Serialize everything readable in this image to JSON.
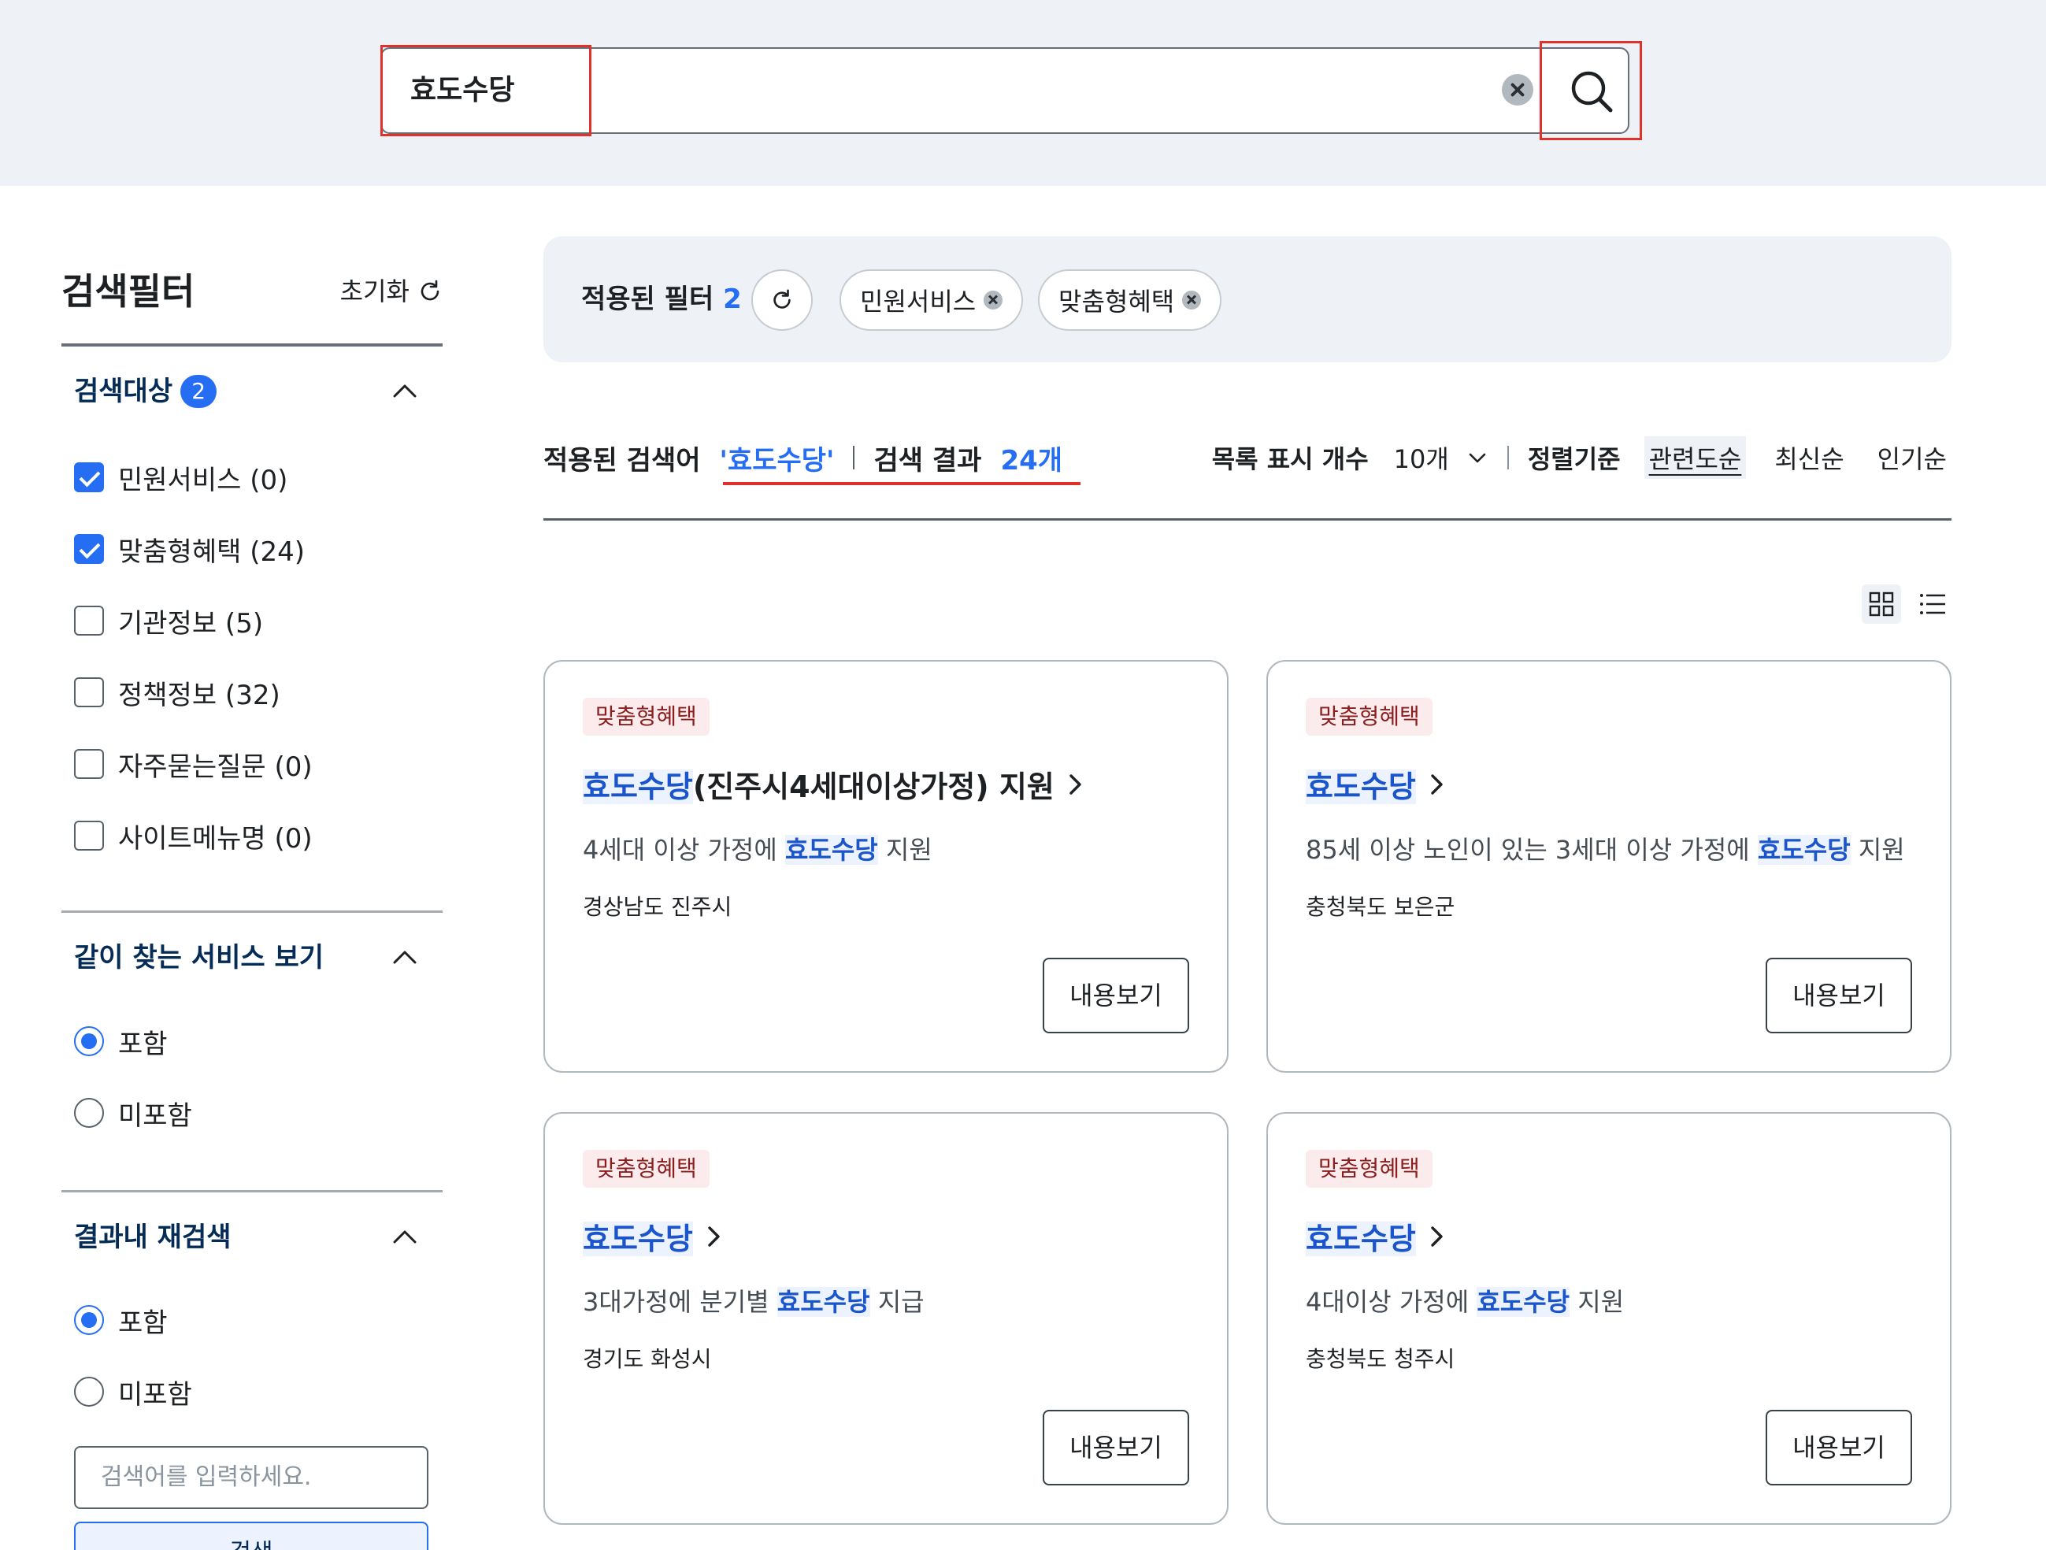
{
  "search": {
    "query": "효도수당"
  },
  "sidebar": {
    "title": "검색필터",
    "reset_label": "초기화",
    "target_group": {
      "title": "검색대상",
      "badge": "2",
      "options": [
        {
          "label": "민원서비스 (0)",
          "checked": true
        },
        {
          "label": "맞춤형혜택 (24)",
          "checked": true
        },
        {
          "label": "기관정보 (5)",
          "checked": false
        },
        {
          "label": "정책정보 (32)",
          "checked": false
        },
        {
          "label": "자주묻는질문 (0)",
          "checked": false
        },
        {
          "label": "사이트메뉴명 (0)",
          "checked": false
        }
      ]
    },
    "related_group": {
      "title": "같이 찾는 서비스 보기",
      "options": [
        {
          "label": "포함",
          "selected": true
        },
        {
          "label": "미포함",
          "selected": false
        }
      ]
    },
    "research_group": {
      "title": "결과내 재검색",
      "options": [
        {
          "label": "포함",
          "selected": true
        },
        {
          "label": "미포함",
          "selected": false
        }
      ],
      "input_placeholder": "검색어를 입력하세요.",
      "button_label": "검색"
    }
  },
  "applied_filters": {
    "label": "적용된 필터",
    "count": "2",
    "chips": [
      "민원서비스",
      "맞춤형혜택"
    ]
  },
  "results_header": {
    "applied_keyword_label": "적용된 검색어",
    "keyword": "'효도수당'",
    "result_label": "검색 결과",
    "result_count": "24개"
  },
  "list_controls": {
    "per_page_label": "목록 표시 개수",
    "per_page_value": "10개",
    "sort_label": "정렬기준",
    "sort_options": [
      "관련도순",
      "최신순",
      "인기순"
    ],
    "active_sort": "관련도순"
  },
  "cards": [
    {
      "tag": "맞춤형혜택",
      "title_hl": "효도수당",
      "title_rest": "(진주시4세대이상가정) 지원",
      "desc_before": "4세대 이상 가정에 ",
      "desc_hl": "효도수당",
      "desc_after": " 지원",
      "region": "경상남도 진주시",
      "button": "내용보기"
    },
    {
      "tag": "맞춤형혜택",
      "title_hl": "효도수당",
      "title_rest": "",
      "desc_before": "85세 이상 노인이 있는 3세대 이상 가정에 ",
      "desc_hl": "효도수당",
      "desc_after": " 지원",
      "region": "충청북도 보은군",
      "button": "내용보기"
    },
    {
      "tag": "맞춤형혜택",
      "title_hl": "효도수당",
      "title_rest": "",
      "desc_before": "3대가정에 분기별 ",
      "desc_hl": "효도수당",
      "desc_after": " 지급",
      "region": "경기도 화성시",
      "button": "내용보기"
    },
    {
      "tag": "맞춤형혜택",
      "title_hl": "효도수당",
      "title_rest": "",
      "desc_before": "4대이상 가정에 ",
      "desc_hl": "효도수당",
      "desc_after": " 지원",
      "region": "충청북도 청주시",
      "button": "내용보기"
    }
  ],
  "colors": {
    "accent": "#256ef4",
    "highlight_box": "#e0322a",
    "tag_bg": "#fcebec",
    "band_bg": "#eef1f6"
  },
  "icons": [
    "clear-icon",
    "search-icon",
    "refresh-icon",
    "chevron-up-icon",
    "chevron-down-icon",
    "chevron-right-icon",
    "grid-view-icon",
    "list-view-icon",
    "remove-chip-icon"
  ]
}
